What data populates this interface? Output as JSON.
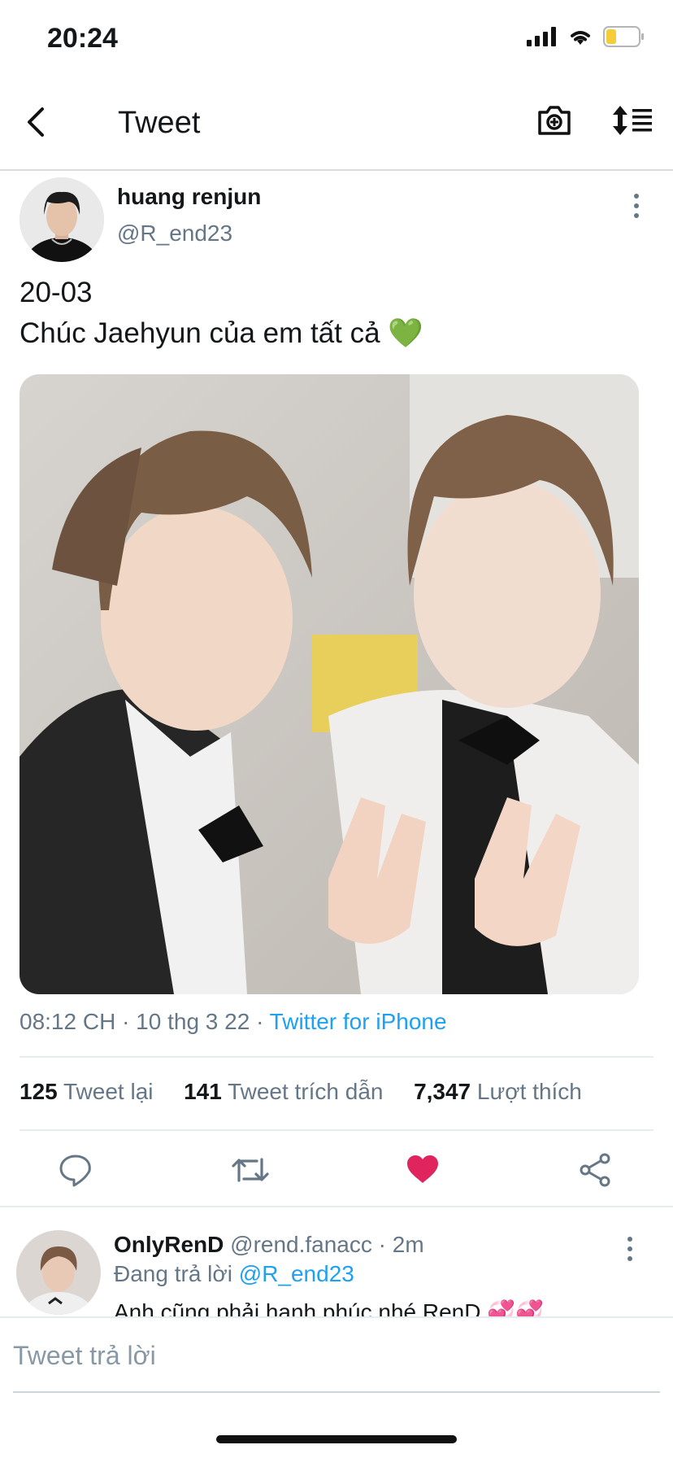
{
  "status": {
    "time": "20:24"
  },
  "nav": {
    "title": "Tweet"
  },
  "tweet": {
    "author_name": "huang renjun",
    "author_handle": "@R_end23",
    "text": "20-03\nChúc Jaehyun của em tất cả 💚",
    "time": "08:12 CH · 10 thg 3 22 · ",
    "source": "Twitter for iPhone",
    "stats": {
      "retweets": "125",
      "retweets_label": "Tweet lại",
      "quotes": "141",
      "quotes_label": "Tweet trích dẫn",
      "likes": "7,347",
      "likes_label": "Lượt thích"
    }
  },
  "reply": {
    "name": "OnlyRenD",
    "handle_time": "@rend.fanacc · 2m",
    "replying_prefix": "Đang trả lời ",
    "replying_to": "@R_end23",
    "text": "Anh cũng phải hạnh phúc nhé RenD 💞💞"
  },
  "compose": {
    "placeholder": "Tweet trả lời"
  },
  "colors": {
    "accent": "#1da1f2",
    "like": "#e0245e",
    "secondary": "#657786"
  },
  "icons": [
    "back-icon",
    "camera-icon",
    "sort-icon",
    "more-icon",
    "reply-icon",
    "retweet-icon",
    "like-icon",
    "share-icon"
  ]
}
